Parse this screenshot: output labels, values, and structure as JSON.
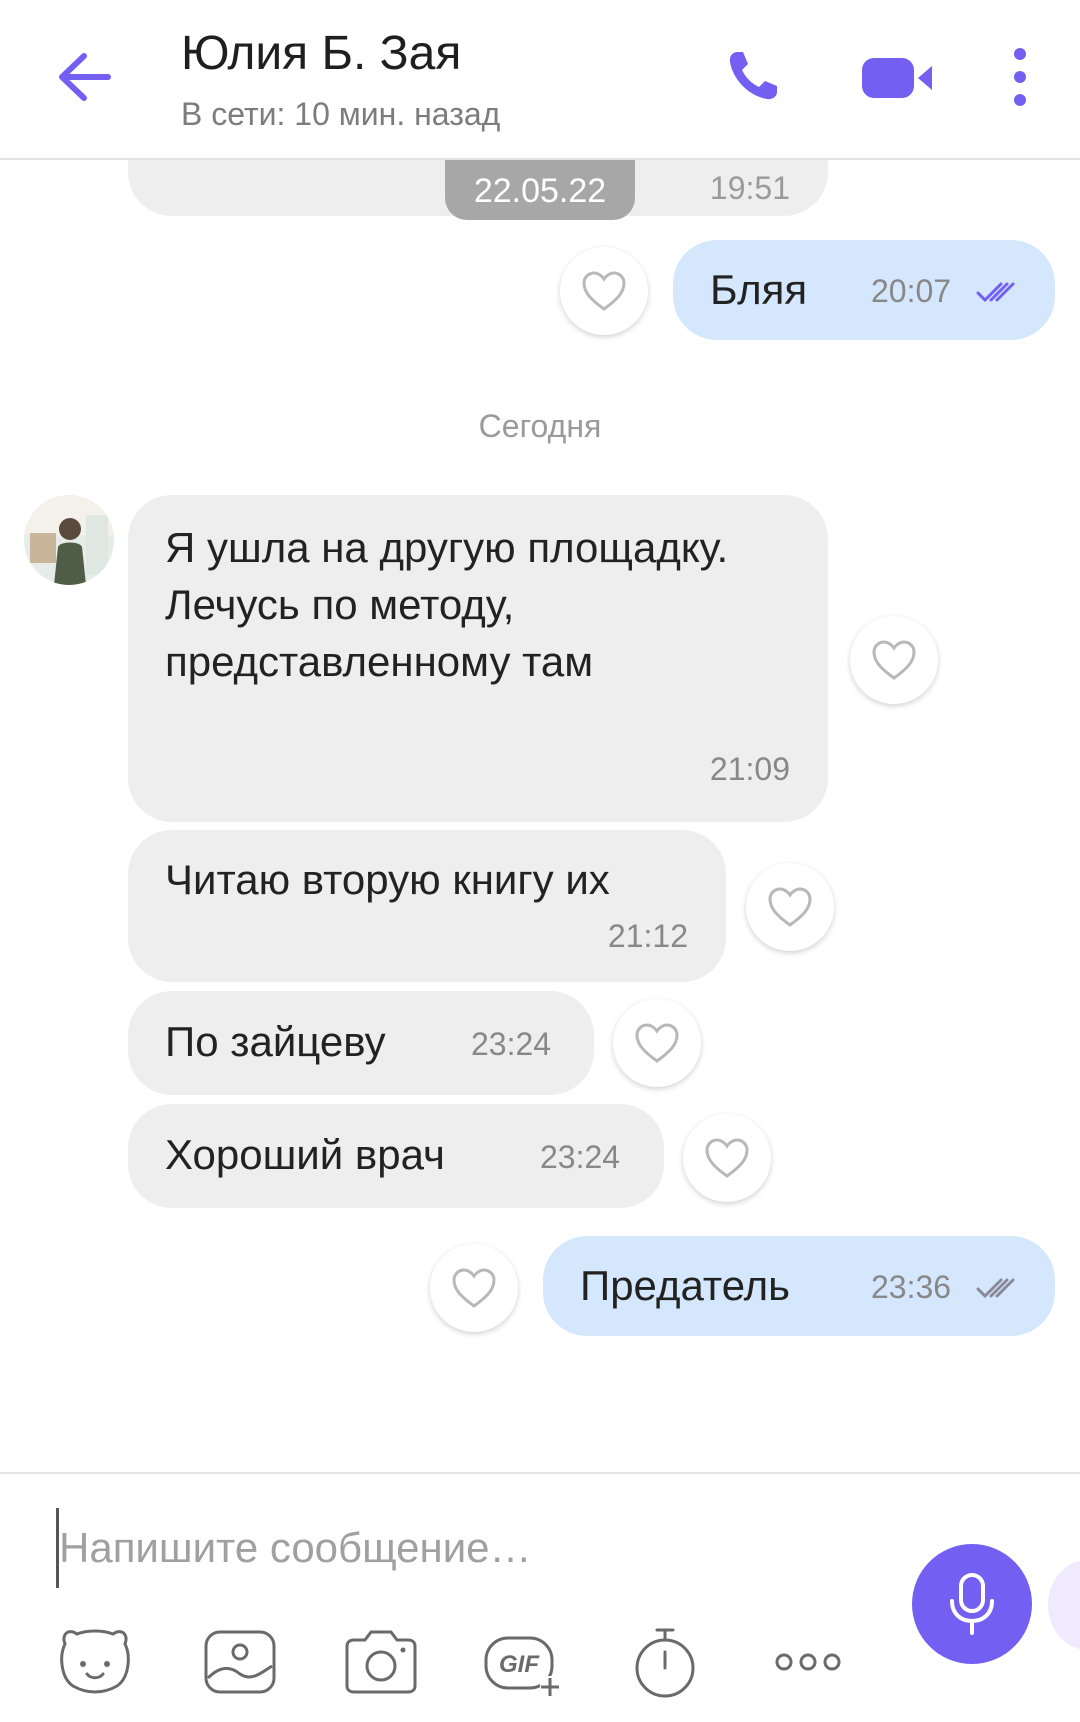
{
  "header": {
    "title": "Юлия Б. Зая",
    "status": "В сети: 10 мин. назад"
  },
  "chat": {
    "date_badge": "22.05.22",
    "day_separator": "Сегодня",
    "partial_time": "19:51",
    "messages": [
      {
        "direction": "outgoing",
        "text": "Бляя",
        "time": "20:07",
        "read": true
      },
      {
        "direction": "incoming",
        "text": "Я ушла на другую площадку. Лечусь по методу, представленному там",
        "time": "21:09"
      },
      {
        "direction": "incoming",
        "text": "Читаю вторую книгу их",
        "time": "21:12"
      },
      {
        "direction": "incoming",
        "text": "По зайцеву",
        "time": "23:24"
      },
      {
        "direction": "incoming",
        "text": "Хороший врач",
        "time": "23:24"
      },
      {
        "direction": "outgoing",
        "text": "Предатель",
        "time": "23:36",
        "read": true
      }
    ]
  },
  "composer": {
    "placeholder": "Напишите сообщение…",
    "tools": [
      "sticker-icon",
      "gallery-icon",
      "camera-icon",
      "gif-icon",
      "timer-icon",
      "more-horizontal-icon"
    ],
    "gif_label": "GIF"
  },
  "colors": {
    "accent": "#7360f2",
    "incoming_bubble": "#eeeeee",
    "outgoing_bubble": "#d4e7fd",
    "date_badge": "#a7a7a7"
  }
}
